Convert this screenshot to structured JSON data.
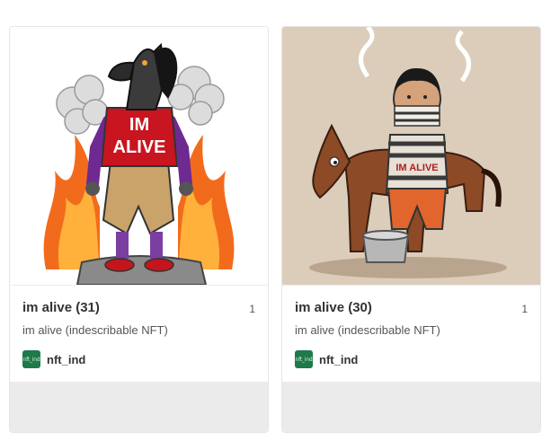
{
  "cards": [
    {
      "title": "im alive (31)",
      "count": "1",
      "description": "im alive (indescribable NFT)",
      "owner": "nft_ind",
      "shirt_text_line1": "IM",
      "shirt_text_line2": "ALIVE"
    },
    {
      "title": "im alive (30)",
      "count": "1",
      "description": "im alive (indescribable NFT)",
      "owner": "nft_ind",
      "shirt_text": "IM ALIVE"
    }
  ],
  "colors": {
    "card_border": "#e6e6e6",
    "footer_bg": "#ebebeb",
    "avatar_bg": "#1e7a4a"
  }
}
